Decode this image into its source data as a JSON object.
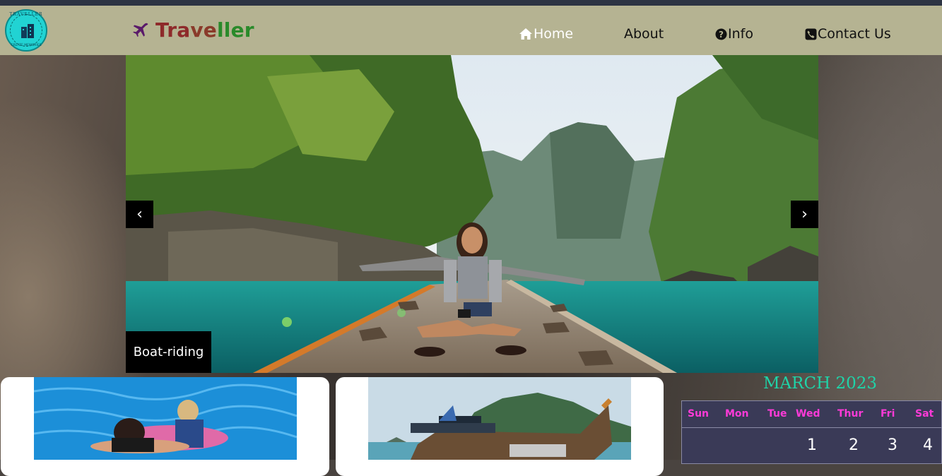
{
  "brand": {
    "name_part1": "Tra",
    "name_part2": "ve",
    "name_part3": "ller"
  },
  "logo": {
    "ring_text": "TRAVELLER",
    "tagline": "CREATE MEMORIES"
  },
  "nav": {
    "home": "Home",
    "about": "About",
    "info": "Info",
    "contact": "Contact Us"
  },
  "carousel": {
    "prev": "‹",
    "next": "›",
    "caption": "Boat-riding"
  },
  "calendar": {
    "title": "MARCH 2023",
    "weekdays": [
      "Sun",
      "Mon",
      "Tue",
      "Wed",
      "Thur",
      "Fri",
      "Sat"
    ],
    "first_row": [
      "1",
      "2",
      "3",
      "4"
    ]
  },
  "colors": {
    "navbar": "#b5b392",
    "accent_calendar_title": "#1fd3a8",
    "weekday_text": "#ff3ad8"
  }
}
